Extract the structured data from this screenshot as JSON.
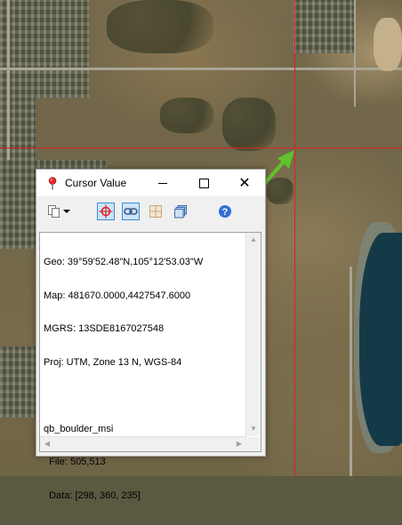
{
  "window": {
    "title": "Cursor Value"
  },
  "toolbar": {
    "items": [
      {
        "name": "copy-dropdown",
        "icon": "copy-icon"
      },
      {
        "name": "crosshair",
        "icon": "crosshair-icon",
        "active": true
      },
      {
        "name": "link",
        "icon": "link-icon",
        "active": true
      },
      {
        "name": "grid",
        "icon": "grid-icon"
      },
      {
        "name": "layers",
        "icon": "layers-icon"
      },
      {
        "name": "help",
        "icon": "help-icon"
      }
    ]
  },
  "cursor_value": {
    "geo": "Geo: 39°59'52.48\"N,105°12'53.03\"W",
    "map": "Map: 481670.0000,4427547.6000",
    "mgrs": "MGRS: 13SDE8167027548",
    "proj": "Proj: UTM, Zone 13 N, WGS-84",
    "layer_name": "qb_boulder_msi",
    "file": "  File: 505,513",
    "data": "  Data: [298, 360, 235]"
  },
  "colors": {
    "crosshair": "#e02020",
    "annotation_arrow": "#62c22b",
    "active_tool_bg": "#cce4f7"
  }
}
